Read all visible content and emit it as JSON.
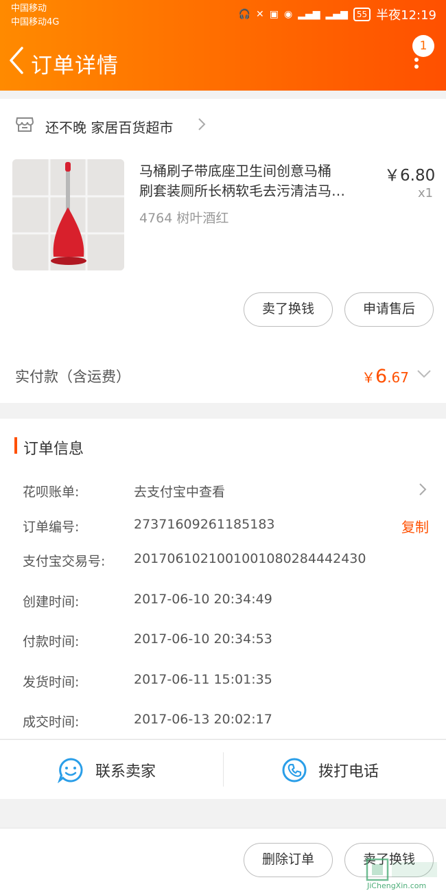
{
  "status_bar": {
    "carrier1": "中国移动",
    "carrier2": "中国移动4G",
    "battery": "55",
    "time": "半夜12:19"
  },
  "header": {
    "title": "订单详情",
    "badge": "1"
  },
  "shop": {
    "name": "还不晚 家居百货超市"
  },
  "product": {
    "title_line1": "马桶刷子带底座卫生间创意马桶",
    "title_line2": "刷套装厕所长柄软毛去污清洁马…",
    "attrs": "4764  树叶酒红",
    "price": "￥6.80",
    "qty": "x1"
  },
  "product_actions": {
    "sell": "卖了换钱",
    "after_sale": "申请售后"
  },
  "payment": {
    "label": "实付款（含运费）",
    "currency": "￥",
    "integer": "6",
    "decimal": ".67"
  },
  "order_info": {
    "title": "订单信息",
    "rows": [
      {
        "label": "花呗账单:",
        "value": "去支付宝中查看"
      },
      {
        "label": "订单编号:",
        "value": "27371609261185183"
      },
      {
        "label": "支付宝交易号:",
        "value": "2017061021001001080284442430"
      },
      {
        "label": "创建时间:",
        "value": "2017-06-10 20:34:49"
      },
      {
        "label": "付款时间:",
        "value": "2017-06-10 20:34:53"
      },
      {
        "label": "发货时间:",
        "value": "2017-06-11 15:01:35"
      },
      {
        "label": "成交时间:",
        "value": "2017-06-13 20:02:17"
      }
    ],
    "copy": "复制"
  },
  "contact": {
    "seller": "联系卖家",
    "phone": "拨打电话"
  },
  "bottom_actions": {
    "delete": "删除订单",
    "sell": "卖了换钱"
  },
  "watermark": {
    "brand": "JiChengXin.com"
  },
  "colors": {
    "accent": "#ff5000",
    "header_start": "#ff8a00",
    "header_end": "#ff5000",
    "icon_blue": "#2a9ee8"
  }
}
